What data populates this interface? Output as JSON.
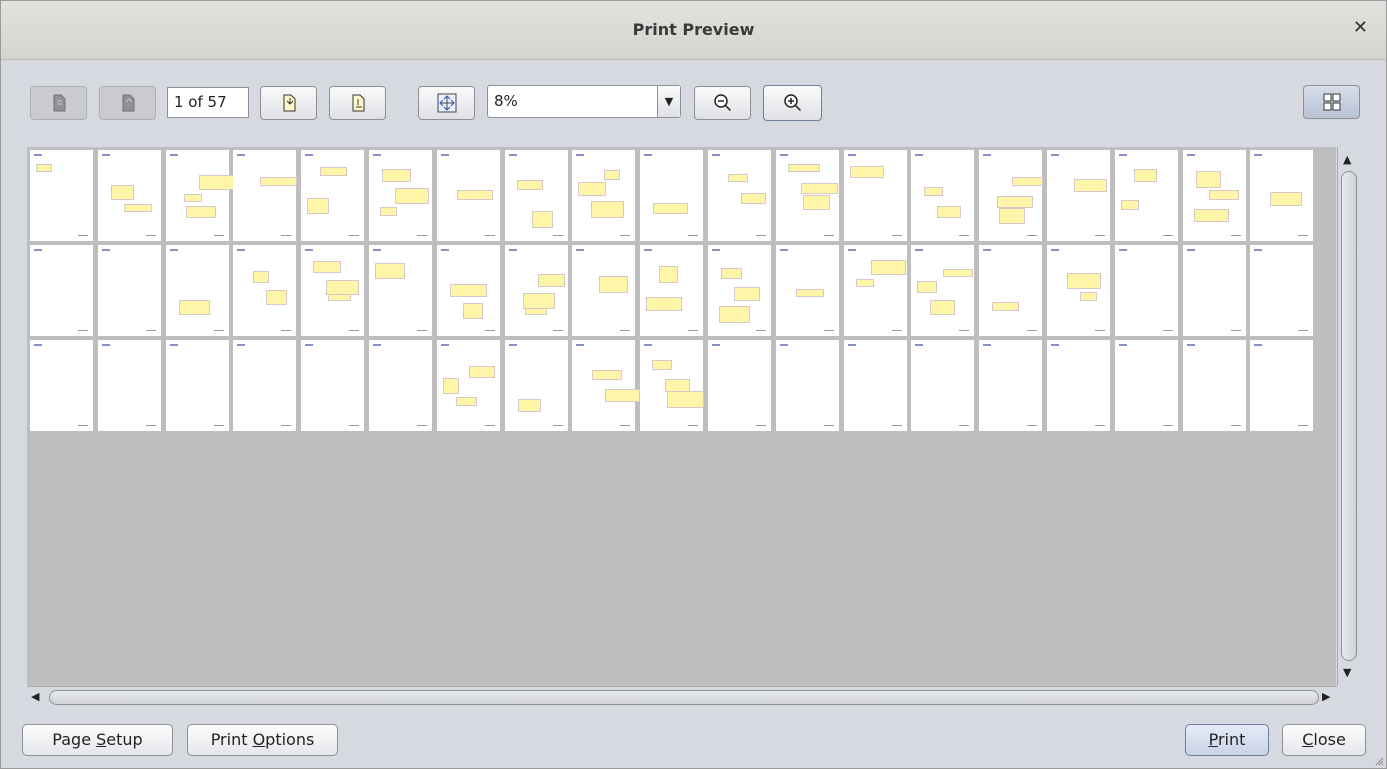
{
  "window": {
    "title": "Print Preview",
    "close_icon": "close-icon"
  },
  "toolbar": {
    "first_page_icon": "first-page-icon",
    "previous_page_icon": "previous-page-icon",
    "page_indicator": "1 of 57",
    "next_page_icon": "next-page-icon",
    "last_page_icon": "last-page-icon",
    "fit_page_icon": "fit-page-icon",
    "zoom_value": "8%",
    "zoom_out_icon": "zoom-out-icon",
    "zoom_in_icon": "zoom-in-icon",
    "multi_page_icon": "multi-page-view-icon"
  },
  "preview": {
    "total_pages": 57,
    "columns": 19,
    "rows_visible": 3,
    "page_color": "#ffffff",
    "background_color": "#bebebe",
    "highlight_color": "#fff5a8"
  },
  "footer": {
    "page_setup_pre": "Page ",
    "page_setup_u": "S",
    "page_setup_post": "etup",
    "print_options_pre": "Print ",
    "print_options_u": "O",
    "print_options_post": "ptions",
    "print_u": "P",
    "print_post": "rint",
    "close_u": "C",
    "close_post": "lose"
  }
}
